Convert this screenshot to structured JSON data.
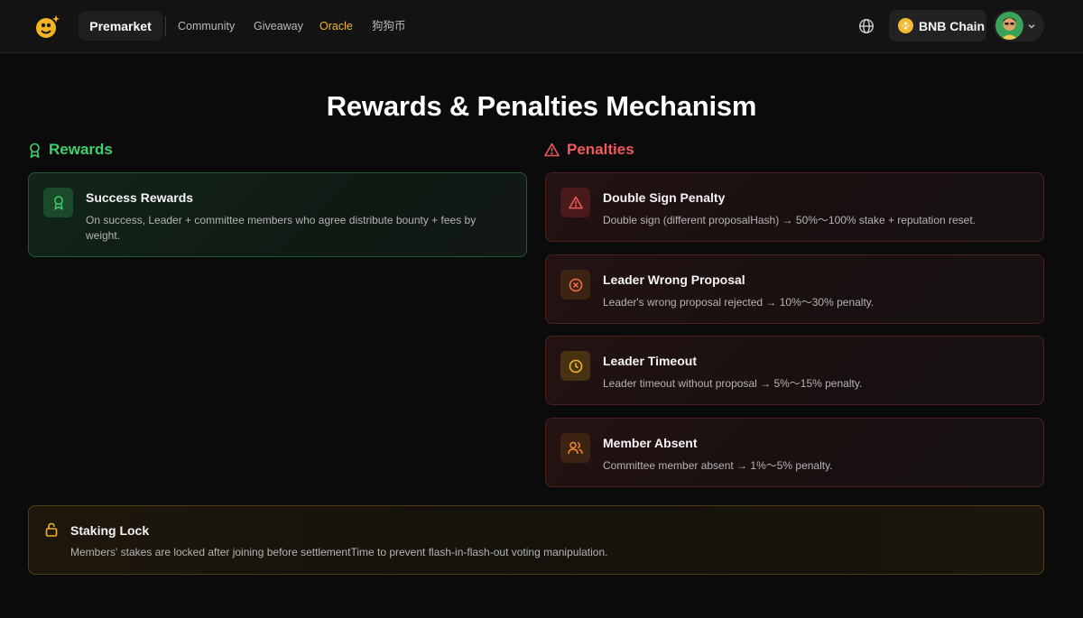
{
  "nav": {
    "brand_pill": "Premarket",
    "links": [
      "Community",
      "Giveaway",
      "Oracle",
      "狗狗币"
    ],
    "active_link": "Oracle",
    "chain_label": "BNB Chain"
  },
  "page": {
    "title": "Rewards & Penalties Mechanism"
  },
  "rewards": {
    "heading": "Rewards",
    "items": [
      {
        "title": "Success Rewards",
        "desc": "On success, Leader + committee members who agree distribute bounty + fees by weight.",
        "icon": "award-icon"
      }
    ]
  },
  "penalties": {
    "heading": "Penalties",
    "items": [
      {
        "title": "Double Sign Penalty",
        "desc": "Double sign (different proposalHash) → 50%～100% stake + reputation reset.",
        "icon": "warning-icon"
      },
      {
        "title": "Leader Wrong Proposal",
        "desc": "Leader's wrong proposal rejected → 10%～30% penalty.",
        "icon": "x-circle-icon"
      },
      {
        "title": "Leader Timeout",
        "desc": "Leader timeout without proposal → 5%～15% penalty.",
        "icon": "clock-icon"
      },
      {
        "title": "Member Absent",
        "desc": "Committee member absent → 1%～5% penalty.",
        "icon": "users-icon"
      }
    ]
  },
  "staking_lock": {
    "title": "Staking Lock",
    "desc": "Members' stakes are locked after joining before settlementTime to prevent flash-in-flash-out voting manipulation.",
    "icon": "lock-icon"
  },
  "colors": {
    "accent": "#f2b423",
    "rewards_green": "#3ecf6e",
    "penalties_red": "#ef5a5a",
    "background": "#0b0b0b"
  }
}
